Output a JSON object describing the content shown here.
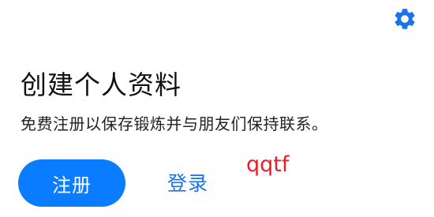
{
  "header": {
    "settings_icon": "gear-icon"
  },
  "profile": {
    "title": "创建个人资料",
    "subtitle": "免费注册以保存锻炼并与朋友们保持联系。"
  },
  "actions": {
    "register_label": "注册",
    "login_label": "登录"
  },
  "annotation": {
    "text": "qqtf"
  },
  "colors": {
    "accent": "#1a73e8",
    "button_bg": "#0a7cff",
    "annotation": "#ee1c24",
    "title": "#111111",
    "subtitle": "#222222"
  }
}
